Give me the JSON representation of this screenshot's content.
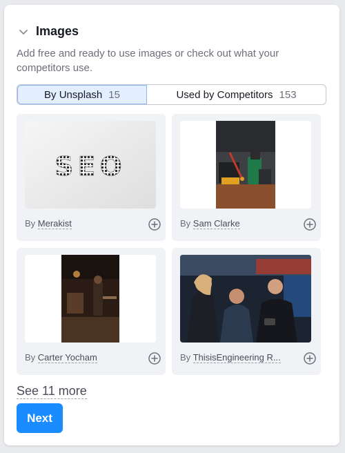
{
  "section": {
    "title": "Images",
    "description": "Add free and ready to use images or check out what your competitors use."
  },
  "tabs": [
    {
      "label": "By Unsplash",
      "count": "15",
      "active": true
    },
    {
      "label": "Used by Competitors",
      "count": "153",
      "active": false
    }
  ],
  "images": [
    {
      "by": "By",
      "author": "Merakist",
      "photo_text": "SEO"
    },
    {
      "by": "By",
      "author": "Sam Clarke"
    },
    {
      "by": "By",
      "author": "Carter Yocham"
    },
    {
      "by": "By",
      "author": "ThisisEngineering R..."
    }
  ],
  "see_more": "See 11 more",
  "next_label": "Next",
  "colors": {
    "accent": "#1a8cff",
    "tab_active_bg": "#e3efff",
    "card_bg": "#f1f2f5"
  }
}
